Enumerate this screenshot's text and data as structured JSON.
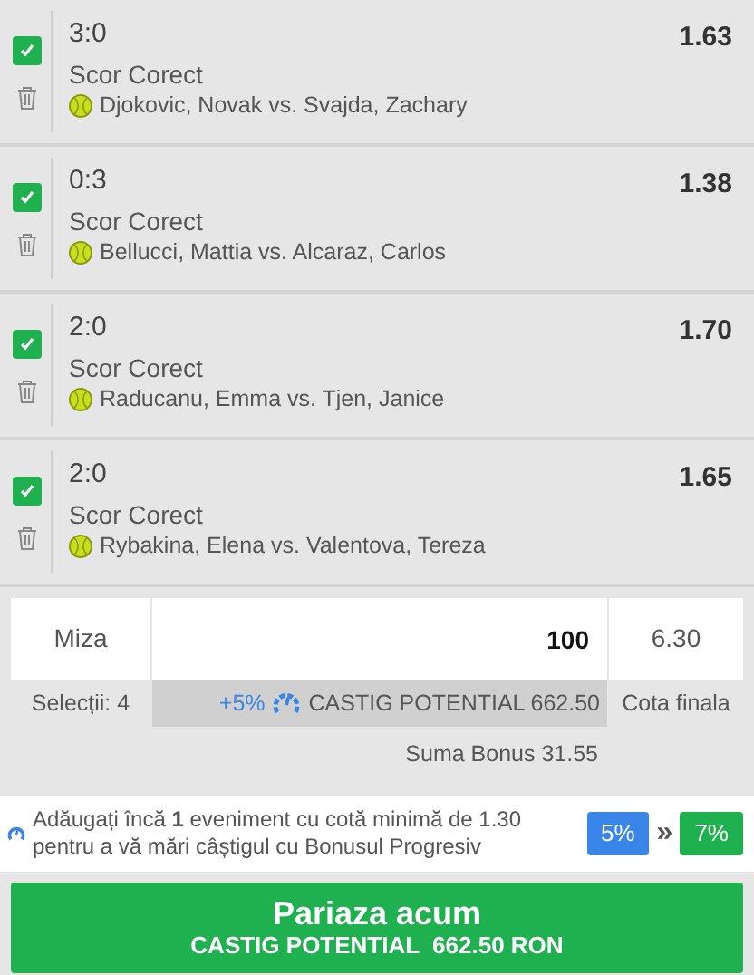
{
  "selections": [
    {
      "checked": true,
      "score": "3:0",
      "market": "Scor Corect",
      "match": "Djokovic, Novak vs. Svajda, Zachary",
      "odds": "1.63"
    },
    {
      "checked": true,
      "score": "0:3",
      "market": "Scor Corect",
      "match": "Bellucci, Mattia vs. Alcaraz, Carlos",
      "odds": "1.38"
    },
    {
      "checked": true,
      "score": "2:0",
      "market": "Scor Corect",
      "match": "Raducanu, Emma vs. Tjen, Janice",
      "odds": "1.70"
    },
    {
      "checked": true,
      "score": "2:0",
      "market": "Scor Corect",
      "match": "Rybakina, Elena vs. Valentova, Tereza",
      "odds": "1.65"
    }
  ],
  "stake": {
    "label": "Miza",
    "value": "100",
    "total_odds": "6.30",
    "selections_count": "Selecții: 4",
    "bonus_percent": "+5%",
    "potential_win": "CASTIG POTENTIAL 662.50",
    "total_odds_label": "Cota finala",
    "bonus_sum": "Suma Bonus 31.55"
  },
  "progressive": {
    "message": "Adăugați încă **1** eveniment cu cotă minimă de 1.30 pentru a vă mări câștigul cu Bonusul Progresiv",
    "current": "5%",
    "arrow": "»",
    "next": "7%"
  },
  "submit": {
    "title": "Pariaza acum",
    "subtitle": "CASTIG POTENTIAL  662.50 RON"
  }
}
